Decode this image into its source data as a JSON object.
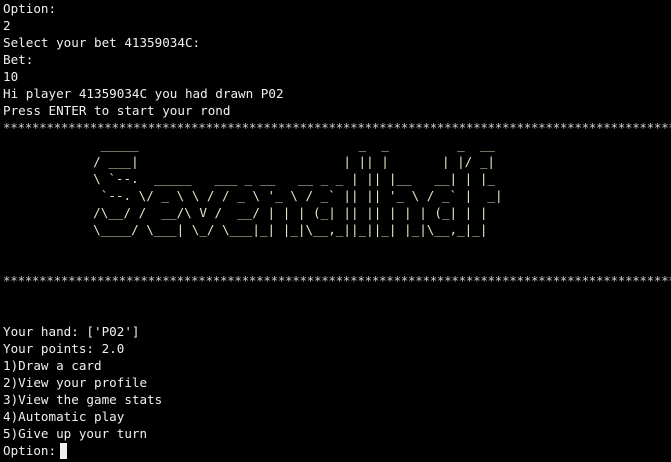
{
  "colors": {
    "background": "#000000",
    "text": "#f0f0f0",
    "banner": "#eae6c8"
  },
  "top_lines": [
    "Option:",
    "2",
    "Select your bet 41359034C:",
    "Bet:",
    "10",
    "Hi player 41359034C you had drawn P02",
    "Press ENTER to start your rond"
  ],
  "separator": "*****************************************************************************************************",
  "banner_art": "   _____                             _  _         _  __\n  / ___|                           | || |       | |/ _|\n  \\ `--.  _____   ___ _ __   __ _ _ | || |__   __| | |_\n   `--. \\/ _ \\ \\ / / _ \\ '_ \\ / _` || || '_ \\ / _` |  _|\n  /\\__/ /  __/\\ V /  __/ | | | (_| || || | | | (_| | |\n  \\____/ \\___| \\_/ \\___|_| |_|\\__,_||_||_| |_|\\__,_|_|",
  "hand_line": "Your hand: ['P02']",
  "points_line": "Your points: 2.0",
  "menu": [
    "1)Draw a card",
    "2)View your profile",
    "3)View the game stats",
    "4)Automatic play",
    "5)Give up your turn"
  ],
  "prompt": "Option:"
}
